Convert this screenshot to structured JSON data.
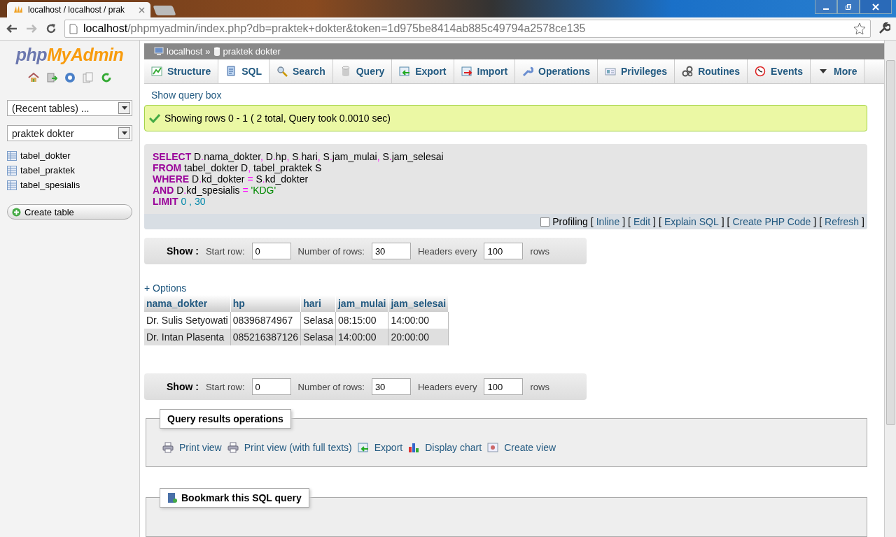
{
  "browser": {
    "tab_title": "localhost / localhost / prak",
    "url_host": "localhost",
    "url_path": "/phpmyadmin/index.php?db=praktek+dokter&token=1d975be8414ab885c49794a2578ce135"
  },
  "sidebar": {
    "logo_php": "php",
    "logo_myadmin": "MyAdmin",
    "recent_tables": "(Recent tables) ...",
    "database": "praktek dokter",
    "tables": [
      "tabel_dokter",
      "tabel_praktek",
      "tabel_spesialis"
    ],
    "create_table": "Create table"
  },
  "breadcrumb": {
    "server": "localhost",
    "separator": "»",
    "database": "praktek dokter"
  },
  "tabs": [
    {
      "label": "Structure",
      "selected": false
    },
    {
      "label": "SQL",
      "selected": true
    },
    {
      "label": "Search",
      "selected": false
    },
    {
      "label": "Query",
      "selected": false
    },
    {
      "label": "Export",
      "selected": false
    },
    {
      "label": "Import",
      "selected": false
    },
    {
      "label": "Operations",
      "selected": false
    },
    {
      "label": "Privileges",
      "selected": false
    },
    {
      "label": "Routines",
      "selected": false
    },
    {
      "label": "Events",
      "selected": false
    },
    {
      "label": "More",
      "selected": false
    }
  ],
  "show_query_box": "Show query box",
  "success_message": "Showing rows 0 - 1 ( 2 total, Query took 0.0010 sec)",
  "sql_lines": [
    [
      {
        "kind": "keyword",
        "text": "SELECT"
      },
      {
        "kind": "ident",
        "text": " D"
      },
      {
        "kind": "punct",
        "text": "."
      },
      {
        "kind": "ident",
        "text": "nama_dokter"
      },
      {
        "kind": "punct",
        "text": ","
      },
      {
        "kind": "ident",
        "text": " D"
      },
      {
        "kind": "punct",
        "text": "."
      },
      {
        "kind": "ident",
        "text": "hp"
      },
      {
        "kind": "punct",
        "text": ","
      },
      {
        "kind": "ident",
        "text": " S"
      },
      {
        "kind": "punct",
        "text": "."
      },
      {
        "kind": "ident",
        "text": "hari"
      },
      {
        "kind": "punct",
        "text": ","
      },
      {
        "kind": "ident",
        "text": " S"
      },
      {
        "kind": "punct",
        "text": "."
      },
      {
        "kind": "ident",
        "text": "jam_mulai"
      },
      {
        "kind": "punct",
        "text": ","
      },
      {
        "kind": "ident",
        "text": " S"
      },
      {
        "kind": "punct",
        "text": "."
      },
      {
        "kind": "ident",
        "text": "jam_selesai"
      }
    ],
    [
      {
        "kind": "keyword",
        "text": "FROM"
      },
      {
        "kind": "ident",
        "text": " tabel_dokter D"
      },
      {
        "kind": "punct",
        "text": ","
      },
      {
        "kind": "ident",
        "text": " tabel_praktek S"
      }
    ],
    [
      {
        "kind": "keyword",
        "text": "WHERE"
      },
      {
        "kind": "ident",
        "text": " D"
      },
      {
        "kind": "punct",
        "text": "."
      },
      {
        "kind": "ident",
        "text": "kd_dokter "
      },
      {
        "kind": "punct",
        "text": "="
      },
      {
        "kind": "ident",
        "text": " S"
      },
      {
        "kind": "punct",
        "text": "."
      },
      {
        "kind": "ident",
        "text": "kd_dokter"
      }
    ],
    [
      {
        "kind": "keyword",
        "text": "AND"
      },
      {
        "kind": "ident",
        "text": " D"
      },
      {
        "kind": "punct",
        "text": "."
      },
      {
        "kind": "ident",
        "text": "kd_spesialis "
      },
      {
        "kind": "punct",
        "text": "="
      },
      {
        "kind": "string",
        "text": " 'KDG'"
      }
    ],
    [
      {
        "kind": "keyword",
        "text": "LIMIT"
      },
      {
        "kind": "number",
        "text": " 0 , 30"
      }
    ]
  ],
  "profiling": {
    "label": "Profiling",
    "checked": false
  },
  "query_links": [
    {
      "open": "[",
      "label": "Inline",
      "close": "]"
    },
    {
      "open": "[",
      "label": "Edit",
      "close": "]"
    },
    {
      "open": "[",
      "label": "Explain SQL",
      "close": "]"
    },
    {
      "open": "[",
      "label": "Create PHP Code",
      "close": "]"
    },
    {
      "open": "[",
      "label": "Refresh",
      "close": "]"
    }
  ],
  "navigation": [
    {
      "show": "Show :",
      "start_row_label": "Start row:",
      "start_row": "0",
      "num_rows_label": "Number of rows:",
      "num_rows": "30",
      "headers_label": "Headers every",
      "headers": "100",
      "rows": "rows"
    },
    {
      "show": "Show :",
      "start_row_label": "Start row:",
      "start_row": "0",
      "num_rows_label": "Number of rows:",
      "num_rows": "30",
      "headers_label": "Headers every",
      "headers": "100",
      "rows": "rows"
    }
  ],
  "options_link": "+ Options",
  "table": {
    "columns": [
      "nama_dokter",
      "hp",
      "hari",
      "jam_mulai",
      "jam_selesai"
    ],
    "rows": [
      [
        "Dr. Sulis Setyowati",
        "08396874967",
        "Selasa",
        "08:15:00",
        "14:00:00"
      ],
      [
        "Dr. Intan Plasenta",
        "085216387126",
        "Selasa",
        "14:00:00",
        "20:00:00"
      ]
    ]
  },
  "query_results_operations": {
    "title": "Query results operations",
    "links": [
      "Print view",
      "Print view (with full texts)",
      "Export",
      "Display chart",
      "Create view"
    ]
  },
  "bookmark": {
    "title": "Bookmark this SQL query"
  }
}
